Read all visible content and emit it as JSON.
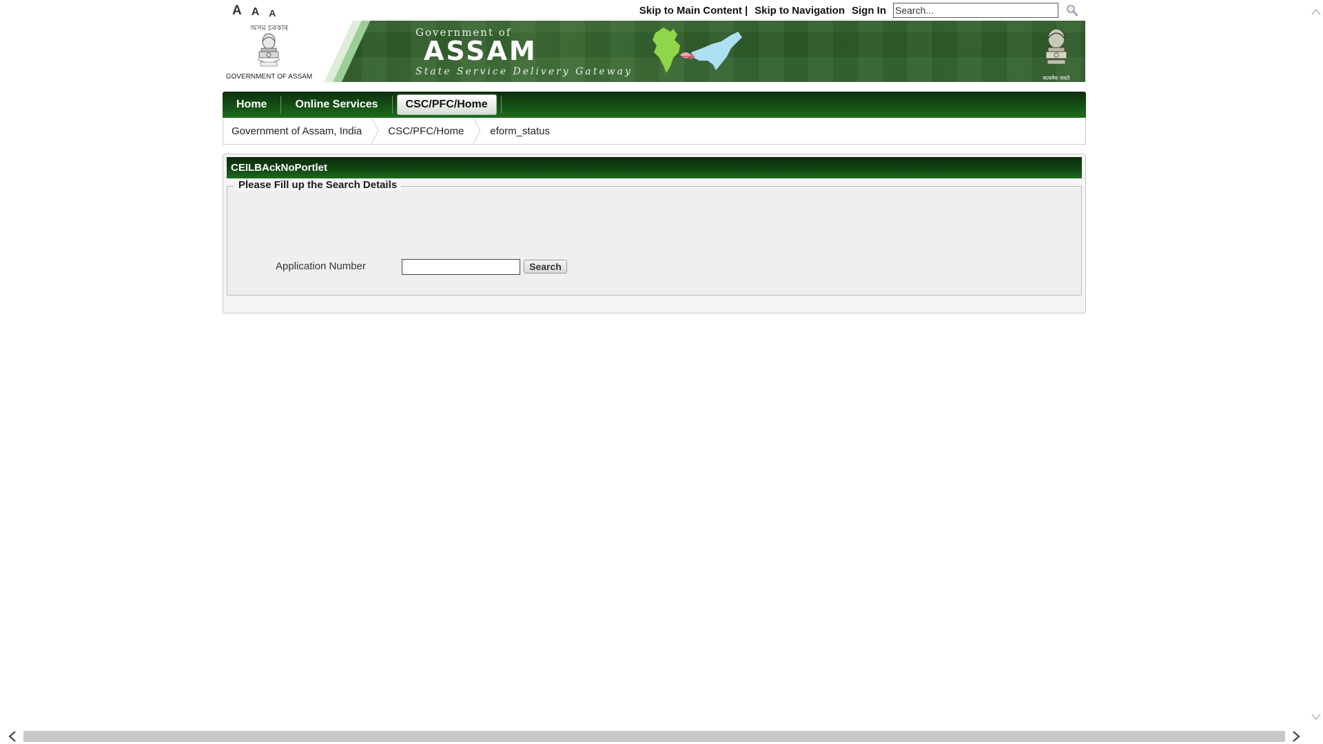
{
  "font_sizer": {
    "large": "A",
    "medium": "A",
    "small": "A"
  },
  "top_links": {
    "skip_main": "Skip to Main Content",
    "separator": "|",
    "skip_nav": "Skip to Navigation",
    "sign_in": "Sign In"
  },
  "search": {
    "placeholder": "Search...",
    "icon": "magnifier-icon"
  },
  "banner": {
    "emblem_script": "অসম চৰকাৰ",
    "emblem_caption": "GOVERNMENT OF ASSAM",
    "title_small": "Government of",
    "title_large": "ASSAM",
    "subtitle": "State Service Delivery Gateway",
    "motto": "सत्यमेव जयते"
  },
  "nav": {
    "items": [
      {
        "label": "Home"
      },
      {
        "label": "Online Services"
      },
      {
        "label": "CSC/PFC/Home",
        "active": true
      }
    ]
  },
  "breadcrumb": [
    {
      "label": "Government of Assam, India"
    },
    {
      "label": "CSC/PFC/Home"
    },
    {
      "label": "eform_status"
    }
  ],
  "portlet": {
    "title": "CEILBAckNoPortlet",
    "legend": "Please Fill up the Search Details",
    "field_label": "Application Number",
    "field_value": "",
    "button_label": "Search"
  },
  "colors": {
    "nav_green_dark": "#0e2f0e",
    "nav_green_light": "#1d6d1c",
    "banner_green": "#2d5a27",
    "fieldset_bg": "#eeeff1"
  }
}
